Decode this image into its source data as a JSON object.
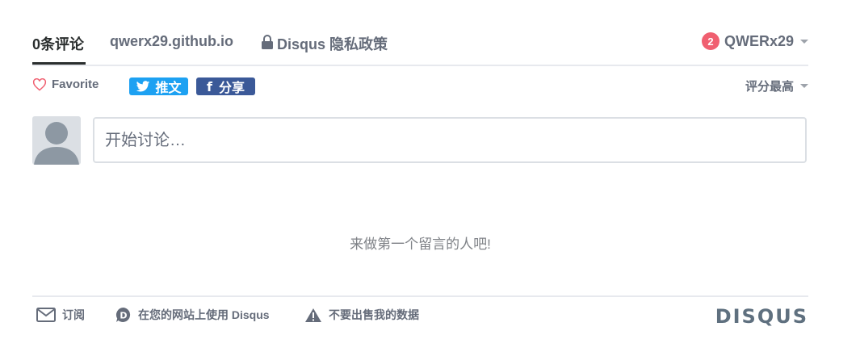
{
  "nav": {
    "comments_tab": "0条评论",
    "site_tab": "qwerx29.github.io",
    "privacy_tab": "Disqus 隐私政策",
    "notification_count": "2",
    "username": "QWERx29"
  },
  "actions": {
    "favorite": "Favorite",
    "tweet": "推文",
    "share": "分享",
    "sort": "评分最高"
  },
  "composer": {
    "placeholder": "开始讨论…"
  },
  "empty_message": "来做第一个留言的人吧!",
  "footer": {
    "subscribe": "订阅",
    "add_disqus": "在您的网站上使用 Disqus",
    "do_not_sell": "不要出售我的数据",
    "brand": "DISQUS"
  },
  "colors": {
    "accent_red": "#f05f70",
    "twitter_blue": "#1da1f2",
    "facebook_blue": "#3b5998",
    "muted_text": "#656c7a"
  }
}
